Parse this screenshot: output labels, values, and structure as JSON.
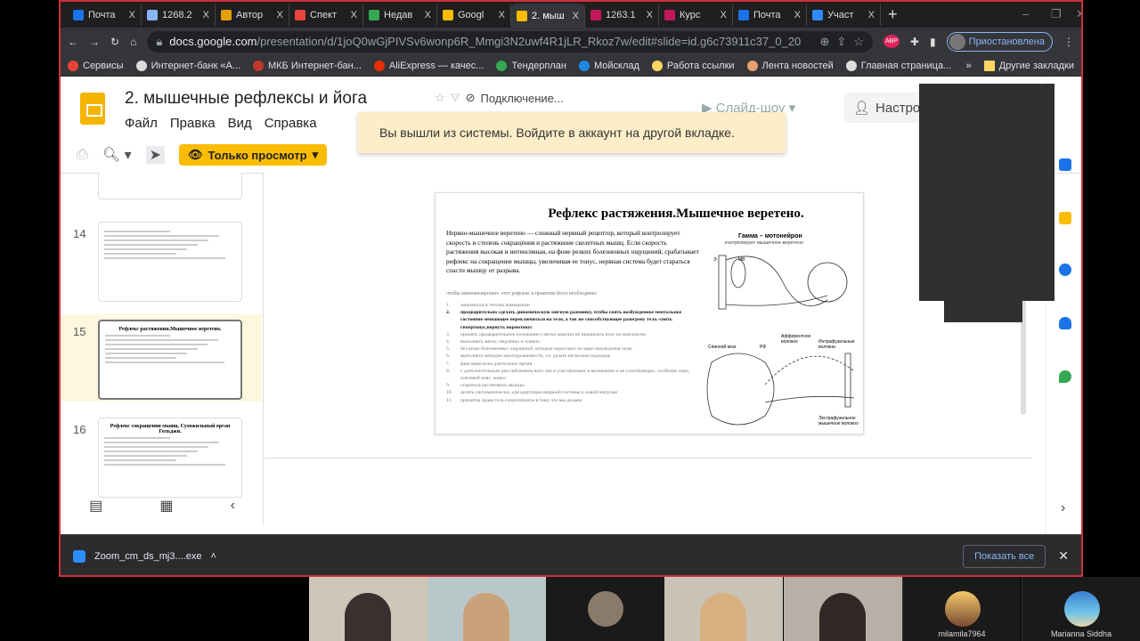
{
  "browser": {
    "tabs": [
      {
        "title": "Почта",
        "color": "#1a73e8"
      },
      {
        "title": "1268.2",
        "color": "#8ab4f8"
      },
      {
        "title": "Автор",
        "color": "#e3a008"
      },
      {
        "title": "Спект",
        "color": "#e8453c"
      },
      {
        "title": "Недав",
        "color": "#34a853"
      },
      {
        "title": "Googl",
        "color": "#fbbc04"
      },
      {
        "title": "2. мыш",
        "color": "#fbbc04",
        "active": true
      },
      {
        "title": "1263.1",
        "color": "#c2185b"
      },
      {
        "title": "Курс",
        "color": "#c2185b"
      },
      {
        "title": "Почта",
        "color": "#1a73e8"
      },
      {
        "title": "Участ",
        "color": "#2d8cff"
      }
    ],
    "close_glyph": "X",
    "url_host": "docs.google.com",
    "url_path": "/presentation/d/1joQ0wGjPIVSv6wonp6R_Mmgi3N2uwf4R1jLR_Rkoz7w/edit#slide=id.g6c73911c37_0_20",
    "profile_status": "Приостановлена",
    "adblock_badge": "ABP",
    "bookmarks": [
      {
        "label": "Сервисы",
        "color": "#ea4335"
      },
      {
        "label": "Интернет-банк «А...",
        "color": "#ddd"
      },
      {
        "label": "МКБ Интернет-бан...",
        "color": "#c0392b"
      },
      {
        "label": "AliExpress — качес...",
        "color": "#e62e04"
      },
      {
        "label": "Тендерплан",
        "color": "#34a853"
      },
      {
        "label": "Мойсклад",
        "color": "#1e88e5"
      },
      {
        "label": "Работа ссылки",
        "color": "#fdd663"
      },
      {
        "label": "Лента новостей",
        "color": "#e8a070"
      },
      {
        "label": "Главная страница...",
        "color": "#ddd"
      }
    ],
    "bookmarks_more": "»",
    "other_bookmarks": "Другие закладки"
  },
  "docs": {
    "title": "2. мышечные рефлексы и йога",
    "connection": "Подключение...",
    "menu": [
      "Файл",
      "Правка",
      "Вид",
      "Справка"
    ],
    "slideshow": "Слайд-шоу",
    "share": "Настро",
    "toast": "Вы вышли из системы. Войдите в аккаунт на другой вкладке.",
    "view_only": "Только просмотр",
    "accent": "#fbbc04"
  },
  "filmstrip": {
    "slides": [
      {
        "num": "",
        "title": ""
      },
      {
        "num": "14",
        "title": ""
      },
      {
        "num": "15",
        "title": "Рефлекс растяжения.Мышечное веретено.",
        "selected": true
      },
      {
        "num": "16",
        "title": "Рефлекс сокращения мышц. Сухожильный орган Гольджи."
      }
    ]
  },
  "slide": {
    "title": "Рефлекс растяжения.Мышечное веретено.",
    "intro": "Нервно-мышечное веретено — сложный нервный рецептор, который контролирует скорость и степень сокращения и растяжение скелетных мышц. Если скорость растяжения высокая и интенсивная, на фоне резких болезненных ощущений, срабатывает рефлекс на сокращение мышцы, увеличивая ее тонус, нервная система будет стараться спасти мышцу от разрыва.",
    "note": "чтобы минимизировать этот рефлекс в практике йоги необходимо:",
    "list": [
      {
        "n": "1.",
        "text": "заниматься в теплом помещении"
      },
      {
        "n": "2.",
        "text": "предварительно сделать динамическую мягкую разминку, чтобы снять возбужденное ментальное состояние мешающее переключиться на тело, а так же способствующее разогреву тела.-снять гипертонус,вернуть нормотонус",
        "bold": true
      },
      {
        "n": "3.",
        "text": "принять предварительное положение ( метод морган) не принимать позу на максимуме."
      },
      {
        "n": "4.",
        "text": "выполнять мягко, медленно и плавно."
      },
      {
        "n": "5.",
        "text": "без резко болезненных ощущений, которые нарастают по мере нахождения позы"
      },
      {
        "n": "6.",
        "text": "выполнять методом многоуровневости, т.е. делать несколько подходов"
      },
      {
        "n": "7.",
        "text": "фиксация позы длительное время"
      },
      {
        "n": "8.",
        "text": "с дополнительным расслаблением всех зон и участвующих в вытяжении и не участвующих, особенно лицо, плечевой пояс, живот"
      },
      {
        "n": "9.",
        "text": "стараться растягивать мышцы"
      },
      {
        "n": "10.",
        "text": "делать систематически, для адаптации нервной системы к новой нагрузке"
      },
      {
        "n": "11.",
        "text": "принятие права тела сопротивляться тому что мы делаем"
      }
    ],
    "diagram_title": "Гамма – мотонейрон",
    "diagram_subtitle": "контролирует мышечное веретено",
    "diagram_labels": [
      "Э",
      "МВ",
      "Спинной мозг",
      "РФ",
      "Афферентное волокно",
      "Интрафузальные волокна",
      "Экстрафузальное мышечное волокно"
    ]
  },
  "download": {
    "file": "Zoom_cm_ds_mj3....exe",
    "show_all": "Показать все",
    "close": "✕"
  },
  "zoom": {
    "participants": [
      {
        "name": "milamila7964"
      },
      {
        "name": "Marianna Siddha"
      }
    ]
  }
}
